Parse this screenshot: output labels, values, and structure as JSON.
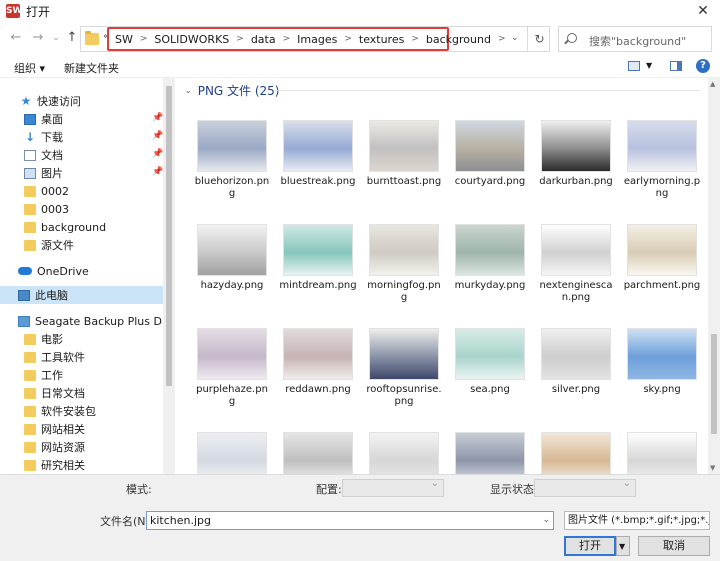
{
  "window": {
    "title": "打开",
    "app_icon": "SW"
  },
  "address": {
    "overflow": "«",
    "crumbs": [
      "SW",
      "SOLIDWORKS",
      "data",
      "Images",
      "textures",
      "background"
    ],
    "highlight_color": "#e03c3c"
  },
  "search": {
    "placeholder": "搜索\"background\""
  },
  "toolbar": {
    "organize": "组织 ▾",
    "new_folder": "新建文件夹"
  },
  "sidebar": {
    "quick_access": "快速访问",
    "items": [
      {
        "label": "桌面",
        "icon": "desktop-icon"
      },
      {
        "label": "下载",
        "icon": "download-icon"
      },
      {
        "label": "文档",
        "icon": "document-icon"
      },
      {
        "label": "图片",
        "icon": "picture-icon"
      },
      {
        "label": "0002",
        "icon": "folder-icon"
      },
      {
        "label": "0003",
        "icon": "folder-icon"
      },
      {
        "label": "background",
        "icon": "folder-icon"
      },
      {
        "label": "源文件",
        "icon": "folder-icon"
      }
    ],
    "onedrive": "OneDrive",
    "this_pc": "此电脑",
    "drive": "Seagate Backup Plus Drive (E",
    "drive_folders": [
      "电影",
      "工具软件",
      "工作",
      "日常文档",
      "软件安装包",
      "网站相关",
      "网站资源",
      "研究相关"
    ]
  },
  "group": {
    "title": "PNG 文件 (25)"
  },
  "files": [
    {
      "name": "bluehorizon.png",
      "colors": [
        "#c9d0dc",
        "#9aa9c4",
        "#e6e9ef"
      ]
    },
    {
      "name": "bluestreak.png",
      "colors": [
        "#d9dfea",
        "#95a9d3",
        "#e8ecf4"
      ]
    },
    {
      "name": "burnttoast.png",
      "colors": [
        "#ece9e4",
        "#c2c0c0",
        "#dcd6cf"
      ]
    },
    {
      "name": "courtyard.png",
      "colors": [
        "#cfd8e2",
        "#b8b0a2",
        "#8d8f92"
      ]
    },
    {
      "name": "darkurban.png",
      "colors": [
        "#f0f0f0",
        "#8d8d8d",
        "#2b2b2b"
      ]
    },
    {
      "name": "earlymorning.png",
      "colors": [
        "#d7dcec",
        "#b7c1df",
        "#f2f2f4"
      ]
    },
    {
      "name": "hazyday.png",
      "colors": [
        "#f2f2f2",
        "#c9c9c9",
        "#a0a0a0"
      ]
    },
    {
      "name": "mintdream.png",
      "colors": [
        "#cfe9e4",
        "#86c6bc",
        "#e7f3f1"
      ]
    },
    {
      "name": "morningfog.png",
      "colors": [
        "#e9e6e0",
        "#cfcac2",
        "#f4f2ee"
      ]
    },
    {
      "name": "murkyday.png",
      "colors": [
        "#c9d6cf",
        "#9fb5aa",
        "#dde6e1"
      ]
    },
    {
      "name": "nextenginescan.png",
      "colors": [
        "#ffffff",
        "#d0d0d0",
        "#f5f5f5"
      ]
    },
    {
      "name": "parchment.png",
      "colors": [
        "#f4efe4",
        "#d8ccb5",
        "#fbf8f1"
      ]
    },
    {
      "name": "purplehaze.png",
      "colors": [
        "#e4dde6",
        "#c4b8c9",
        "#efeaf1"
      ]
    },
    {
      "name": "reddawn.png",
      "colors": [
        "#e2dcdc",
        "#c6b3b3",
        "#f1ecec"
      ]
    },
    {
      "name": "rooftopsunrise.png",
      "colors": [
        "#eeeeec",
        "#8a93a8",
        "#40486a"
      ]
    },
    {
      "name": "sea.png",
      "colors": [
        "#d8ece8",
        "#a9d3cc",
        "#eaf5f3"
      ]
    },
    {
      "name": "silver.png",
      "colors": [
        "#f0f0f0",
        "#cdcdcd",
        "#e2e2e2"
      ]
    },
    {
      "name": "sky.png",
      "colors": [
        "#cfe0f4",
        "#6d9fd9",
        "#8fb6e4"
      ]
    },
    {
      "name": "",
      "colors": [
        "#eceef2",
        "#d4d9e2",
        "#f6f7f9"
      ]
    },
    {
      "name": "",
      "colors": [
        "#e6e6e6",
        "#bfbfbf",
        "#f2f2f2"
      ]
    },
    {
      "name": "",
      "colors": [
        "#f3f3f3",
        "#d6d6d6",
        "#ebebeb"
      ]
    },
    {
      "name": "",
      "colors": [
        "#c8ccd6",
        "#8d95a8",
        "#dde0e6"
      ]
    },
    {
      "name": "",
      "colors": [
        "#f2e6d8",
        "#d7b895",
        "#f7f0e8"
      ]
    },
    {
      "name": "",
      "colors": [
        "#ffffff",
        "#d6d6d6",
        "#f4f4f4"
      ]
    }
  ],
  "bottom": {
    "template_label": "模式:",
    "config_label": "配置:",
    "display_label": "显示状态:",
    "filename_label": "文件名(N):",
    "filename_value": "kitchen.jpg",
    "filetype_value": "图片文件 (*.bmp;*.gif;*.jpg;*.jp",
    "open_label": "打开",
    "cancel_label": "取消"
  }
}
